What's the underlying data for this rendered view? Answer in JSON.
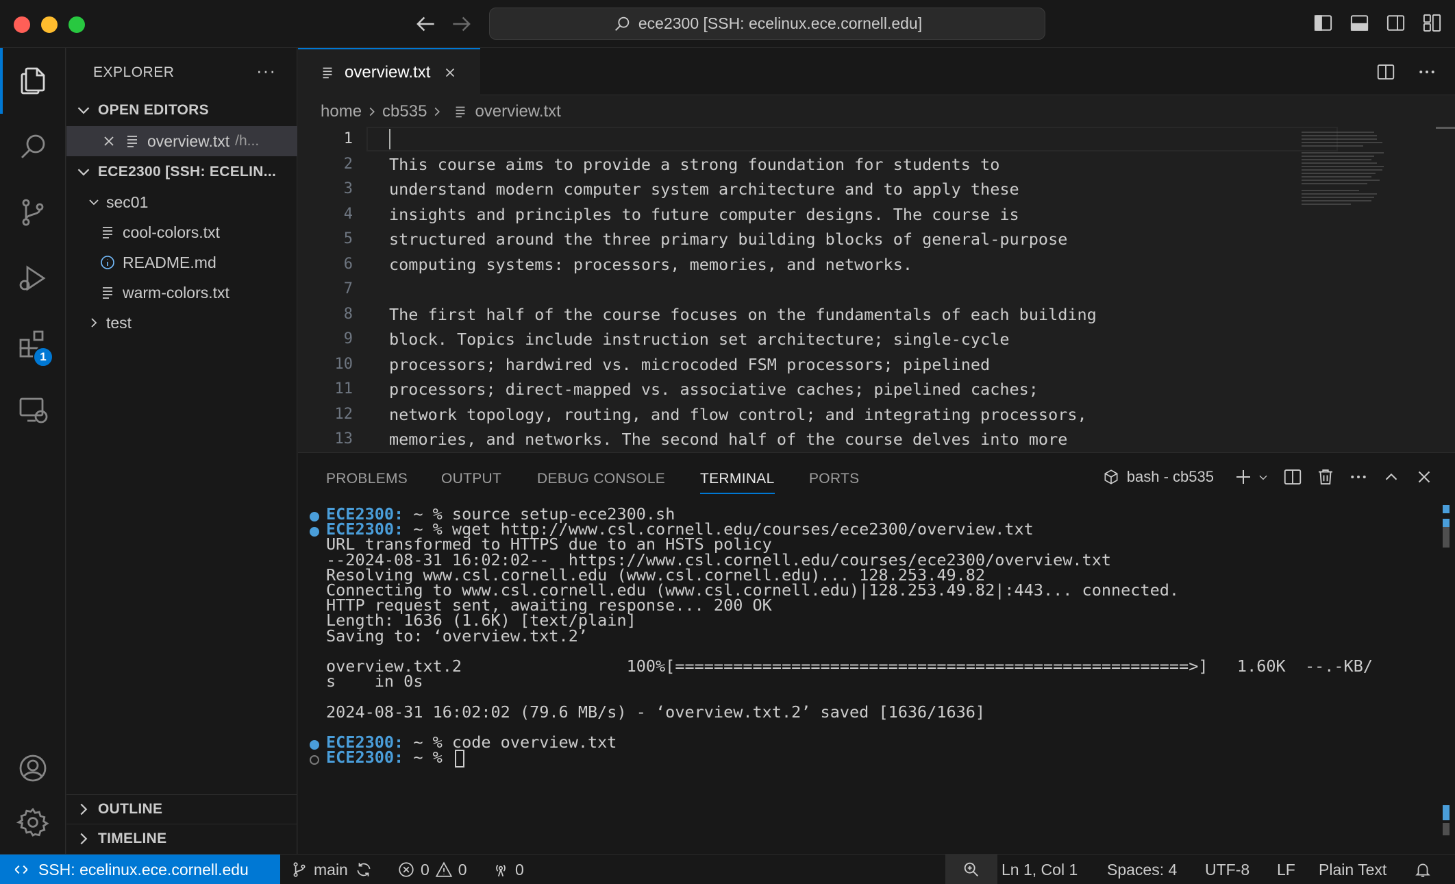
{
  "window": {
    "command_center": "ece2300 [SSH: ecelinux.ece.cornell.edu]"
  },
  "activity_bar": {
    "items": [
      "explorer-icon",
      "search-icon",
      "source-control-icon",
      "run-debug-icon",
      "extensions-icon",
      "remote-explorer-icon"
    ],
    "extensions_badge": "1",
    "bottom": [
      "accounts-icon",
      "settings-gear-icon"
    ]
  },
  "sidebar": {
    "title": "EXPLORER",
    "more": "···",
    "open_editors": {
      "label": "OPEN EDITORS",
      "items": [
        {
          "name": "overview.txt",
          "path": "/h..."
        }
      ]
    },
    "workspace": {
      "label": "ECE2300 [SSH: ECELIN...",
      "folders": [
        {
          "name": "sec01",
          "expanded": true,
          "files": [
            "cool-colors.txt",
            "README.md",
            "warm-colors.txt"
          ]
        },
        {
          "name": "test",
          "expanded": false
        }
      ]
    },
    "outline_label": "OUTLINE",
    "timeline_label": "TIMELINE"
  },
  "editor": {
    "tab": {
      "name": "overview.txt"
    },
    "breadcrumb": [
      "home",
      "cb535",
      "overview.txt"
    ],
    "lines": [
      "",
      "This course aims to provide a strong foundation for students to",
      "understand modern computer system architecture and to apply these",
      "insights and principles to future computer designs. The course is",
      "structured around the three primary building blocks of general-purpose",
      "computing systems: processors, memories, and networks.",
      "",
      "The first half of the course focuses on the fundamentals of each building",
      "block. Topics include instruction set architecture; single-cycle",
      "processors; hardwired vs. microcoded FSM processors; pipelined",
      "processors; direct-mapped vs. associative caches; pipelined caches;",
      "network topology, routing, and flow control; and integrating processors,",
      "memories, and networks. The second half of the course delves into more"
    ],
    "line_numbers": [
      "1",
      "2",
      "3",
      "4",
      "5",
      "6",
      "7",
      "8",
      "9",
      "10",
      "11",
      "12",
      "13"
    ]
  },
  "panel": {
    "tabs": [
      "PROBLEMS",
      "OUTPUT",
      "DEBUG CONSOLE",
      "TERMINAL",
      "PORTS"
    ],
    "active_tab": "TERMINAL",
    "shell_label": "bash - cb535",
    "terminal": {
      "prompt": "ECE2300:",
      "lines": [
        {
          "prompt": true,
          "cmd": " ~ % source setup-ece2300.sh"
        },
        {
          "prompt": true,
          "cmd": " ~ % wget http://www.csl.cornell.edu/courses/ece2300/overview.txt"
        },
        {
          "text": "URL transformed to HTTPS due to an HSTS policy"
        },
        {
          "text": "--2024-08-31 16:02:02--  https://www.csl.cornell.edu/courses/ece2300/overview.txt"
        },
        {
          "text": "Resolving www.csl.cornell.edu (www.csl.cornell.edu)... 128.253.49.82"
        },
        {
          "text": "Connecting to www.csl.cornell.edu (www.csl.cornell.edu)|128.253.49.82|:443... connected."
        },
        {
          "text": "HTTP request sent, awaiting response... 200 OK"
        },
        {
          "text": "Length: 1636 (1.6K) [text/plain]"
        },
        {
          "text": "Saving to: ‘overview.txt.2’"
        },
        {
          "text": ""
        },
        {
          "text": "overview.txt.2                 100%[=====================================================>]   1.60K  --.-KB/"
        },
        {
          "text": "s    in 0s"
        },
        {
          "text": ""
        },
        {
          "text": "2024-08-31 16:02:02 (79.6 MB/s) - ‘overview.txt.2’ saved [1636/1636]"
        },
        {
          "text": ""
        },
        {
          "prompt": true,
          "cmd": " ~ % code overview.txt"
        },
        {
          "prompt": true,
          "cmd": " ~ % ",
          "hollow": true,
          "cursor": true
        }
      ]
    }
  },
  "statusbar": {
    "remote": "SSH: ecelinux.ece.cornell.edu",
    "branch": "main",
    "errors": "0",
    "warnings": "0",
    "ports": "0",
    "position": "Ln 1, Col 1",
    "spaces": "Spaces: 4",
    "encoding": "UTF-8",
    "eol": "LF",
    "language": "Plain Text"
  },
  "colors": {
    "accent": "#0078d4",
    "prompt": "#4a9eda"
  }
}
